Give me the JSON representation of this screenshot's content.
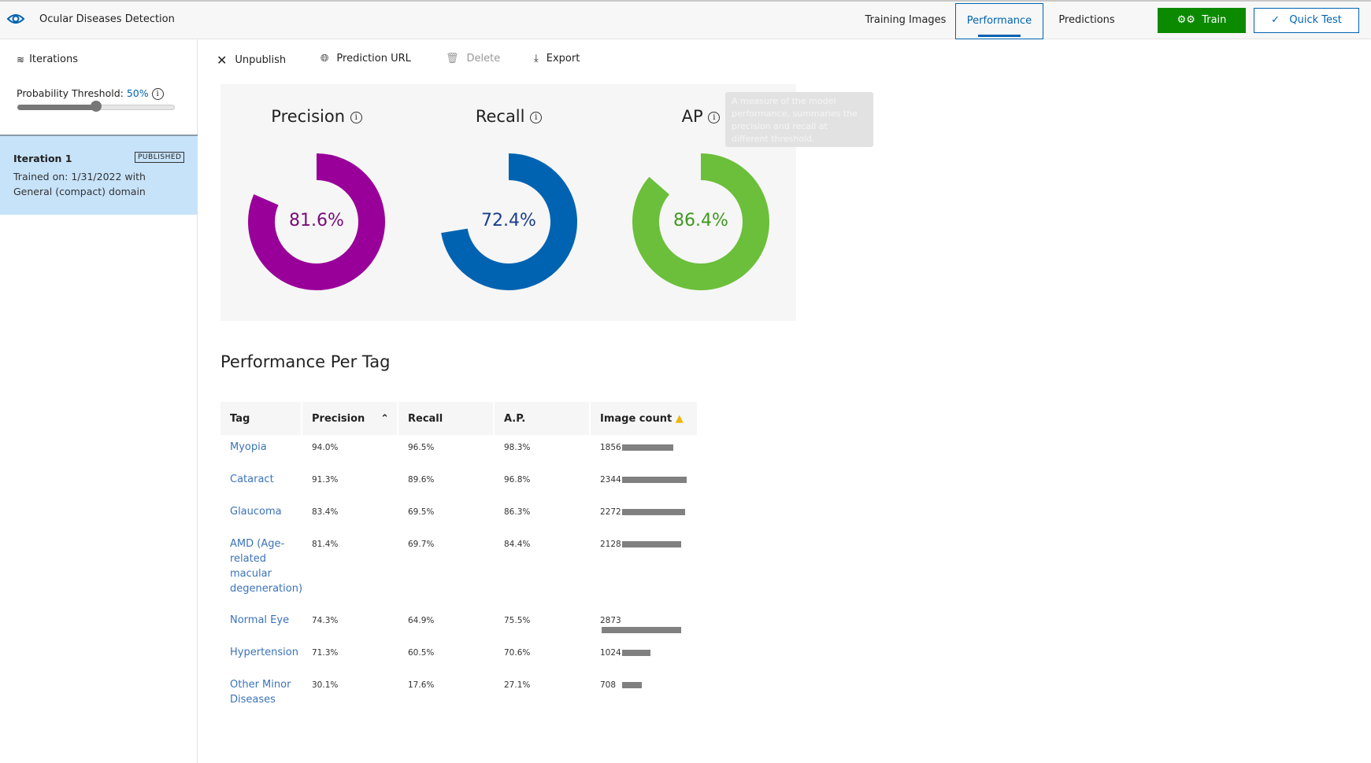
{
  "header": {
    "title": "Ocular Diseases Detection",
    "tabs": [
      {
        "label": "Training Images",
        "active": false
      },
      {
        "label": "Performance",
        "active": true
      },
      {
        "label": "Predictions",
        "active": false
      }
    ],
    "train_label": "Train",
    "quick_test_label": "Quick Test"
  },
  "sidebar": {
    "iterations_label": "Iterations",
    "threshold_label": "Probability Threshold:",
    "threshold_value": "50%",
    "threshold": 0.5,
    "iteration": {
      "name": "Iteration 1",
      "badge": "PUBLISHED",
      "trained": "Trained on: 1/31/2022 with General (compact) domain"
    }
  },
  "toolbar": {
    "unpublish": "Unpublish",
    "prediction_url": "Prediction URL",
    "delete": "Delete",
    "export": "Export"
  },
  "metrics": [
    {
      "title": "Precision",
      "value": "81.6%",
      "fraction": 0.816,
      "color": "#990099"
    },
    {
      "title": "Recall",
      "value": "72.4%",
      "fraction": 0.724,
      "color": "#0063b1"
    },
    {
      "title": "AP",
      "value": "86.4%",
      "fraction": 0.864,
      "color": "#6bbf3a"
    }
  ],
  "tooltip": "A measure of the model performance, summaries the precision and recall at different threshold.",
  "per_tag": {
    "title": "Performance Per Tag",
    "headers": [
      "Tag",
      "Precision",
      "Recall",
      "A.P.",
      "Image count"
    ],
    "rows": [
      {
        "tag": "Myopia",
        "precision": "94.0%",
        "recall": "96.5%",
        "ap": "98.3%",
        "count": 1856
      },
      {
        "tag": "Cataract",
        "precision": "91.3%",
        "recall": "89.6%",
        "ap": "96.8%",
        "count": 2344
      },
      {
        "tag": "Glaucoma",
        "precision": "83.4%",
        "recall": "69.5%",
        "ap": "86.3%",
        "count": 2272
      },
      {
        "tag": "AMD (Age-related macular degeneration)",
        "precision": "81.4%",
        "recall": "69.7%",
        "ap": "84.4%",
        "count": 2128
      },
      {
        "tag": "Normal Eye",
        "precision": "74.3%",
        "recall": "64.9%",
        "ap": "75.5%",
        "count": 2873
      },
      {
        "tag": "Hypertension",
        "precision": "71.3%",
        "recall": "60.5%",
        "ap": "70.6%",
        "count": 1024
      },
      {
        "tag": "Other Minor Diseases",
        "precision": "30.1%",
        "recall": "17.6%",
        "ap": "27.1%",
        "count": 708
      }
    ]
  }
}
